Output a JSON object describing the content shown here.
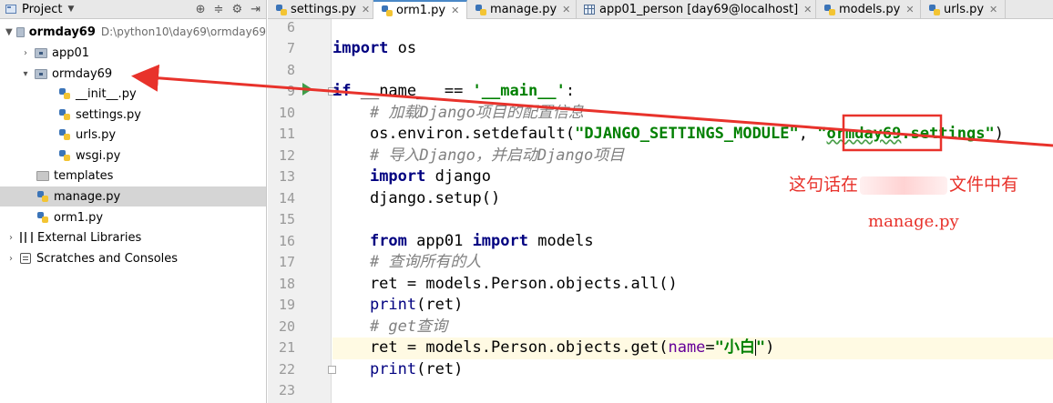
{
  "project_panel": {
    "title": "Project",
    "tree": [
      {
        "label": "ormday69",
        "path": "D:\\python10\\day69\\ormday69"
      },
      {
        "label": "app01"
      },
      {
        "label": "ormday69"
      },
      {
        "label": "__init__.py"
      },
      {
        "label": "settings.py"
      },
      {
        "label": "urls.py"
      },
      {
        "label": "wsgi.py"
      },
      {
        "label": "templates"
      },
      {
        "label": "manage.py"
      },
      {
        "label": "orm1.py"
      },
      {
        "label": "External Libraries"
      },
      {
        "label": "Scratches and Consoles"
      }
    ]
  },
  "tabs": [
    {
      "label": "settings.py"
    },
    {
      "label": "orm1.py"
    },
    {
      "label": "manage.py"
    },
    {
      "label": "app01_person [day69@localhost]"
    },
    {
      "label": "models.py"
    },
    {
      "label": "urls.py"
    }
  ],
  "editor": {
    "line_numbers": [
      "6",
      "7",
      "8",
      "9",
      "10",
      "11",
      "12",
      "13",
      "14",
      "15",
      "16",
      "17",
      "18",
      "19",
      "20",
      "21",
      "22",
      "23"
    ],
    "code": {
      "l7_kw": "import",
      "l7_rest": " os",
      "l9_kw": "if",
      "l9_mid": " __name__ == ",
      "l9_str": "'__main__'",
      "l9_end": ":",
      "l10_cmt": "    # 加载Django项目的配置信息",
      "l11_a": "    os.environ.setdefault(",
      "l11_str1": "\"DJANGO_SETTINGS_MODULE\"",
      "l11_comma": ", ",
      "l11_q": "\"",
      "l11_mod": "ormday69",
      "l11_rest": ".settings\"",
      "l11_end": ")",
      "l12_cmt": "    # 导入Django，并启动Django项目",
      "l13_kw": "import",
      "l13_rest": " django",
      "l14": "    django.setup()",
      "l16_kw1": "from",
      "l16_mid": " app01 ",
      "l16_kw2": "import",
      "l16_rest": " models",
      "l17_cmt": "    # 查询所有的人",
      "l18": "    ret = models.Person.objects.all()",
      "l19_fn": "print",
      "l19_rest": "(ret)",
      "l20_cmt": "    # get查询",
      "l21_a": "    ret = models.Person.objects.get(",
      "l21_param": "name",
      "l21_eq": "=",
      "l21_str": "\"小白",
      "l21_q": "\"",
      "l21_end": ")",
      "l22_fn": "print",
      "l22_rest": "(ret)"
    }
  },
  "annotations": {
    "note_prefix": "这句话在",
    "note_suffix": "文件中有",
    "file": "manage.py",
    "color": "#e8322b"
  }
}
